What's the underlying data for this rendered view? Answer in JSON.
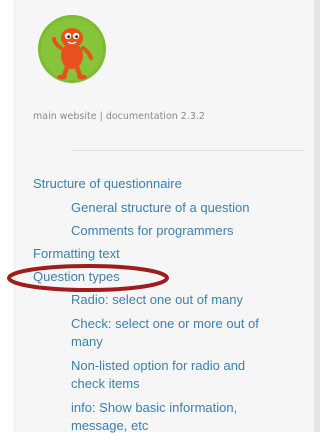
{
  "sidebar": {
    "logo_icon": "orange-creature-logo",
    "links": {
      "main_website": "main website",
      "separator": "|",
      "documentation": "documentation 2.3.2"
    },
    "toc": [
      {
        "label": "Structure of questionnaire",
        "level": 1
      },
      {
        "label": "General structure of a question",
        "level": 2
      },
      {
        "label": "Comments for programmers",
        "level": 2
      },
      {
        "label": "Formatting text",
        "level": 1
      },
      {
        "label": "Question types",
        "level": 1
      },
      {
        "label": "Radio: select one out of many",
        "level": 2
      },
      {
        "label": "Check: select one or more out of",
        "level": 2
      },
      {
        "label": "many",
        "level": 2
      },
      {
        "label": "Non-listed option for radio and",
        "level": 2
      },
      {
        "label": "check items",
        "level": 2
      },
      {
        "label": "info: Show basic information,",
        "level": 2
      },
      {
        "label": "message, etc",
        "level": 2
      }
    ]
  },
  "colors": {
    "link": "#3f7fae",
    "annotation_ellipse": "#a01c1c",
    "logo_background": "#7dbb33",
    "logo_creature": "#e8501e"
  }
}
